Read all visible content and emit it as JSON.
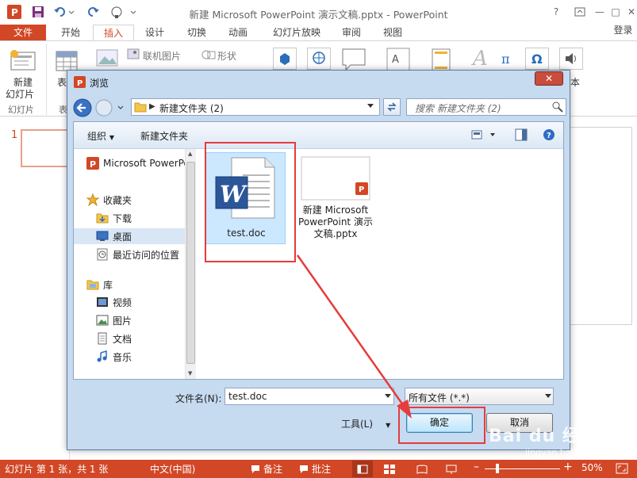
{
  "window": {
    "title": "新建 Microsoft PowerPoint 演示文稿.pptx - PowerPoint",
    "login": "登录",
    "app_icon_letter": "P",
    "window_controls": [
      "?",
      "—",
      "□",
      "✕"
    ]
  },
  "tabs": [
    "文件",
    "开始",
    "插入",
    "设计",
    "切换",
    "动画",
    "幻灯片放映",
    "审阅",
    "视图"
  ],
  "ribbon": {
    "new_slide": "新建\n幻灯片",
    "new_slide_line1": "新建",
    "new_slide_line2": "幻灯片",
    "group_slides": "幻灯片",
    "table": "表",
    "group_table": "表",
    "online_pictures": "联机图片",
    "shapes": "形状",
    "partial_right": "本",
    "accent": "#d24726"
  },
  "slide_pane": {
    "slide_number": "1"
  },
  "dialog": {
    "title": "浏览",
    "close": "✕",
    "address_folder": "新建文件夹 (2)",
    "search_placeholder": "搜索 新建文件夹 (2)",
    "toolbar": {
      "organize": "组织",
      "new_folder": "新建文件夹"
    },
    "nav": {
      "top_item": "Microsoft PowerPoint",
      "favorites": "收藏夹",
      "downloads": "下载",
      "desktop": "桌面",
      "recent": "最近访问的位置",
      "libraries": "库",
      "videos": "视频",
      "pictures": "图片",
      "documents": "文档",
      "music": "音乐"
    },
    "files": [
      {
        "name": "test.doc",
        "type": "word",
        "selected": true
      },
      {
        "name_line1": "新建 Microsoft",
        "name_line2": "PowerPoint 演示",
        "name_line3": "文稿.pptx",
        "type": "pptx",
        "selected": false
      }
    ],
    "filename_label": "文件名(N):",
    "filename_value": "test.doc",
    "filetype_value": "所有文件 (*.*)",
    "tools": "工具(L)",
    "ok": "确定",
    "cancel": "取消"
  },
  "statusbar": {
    "slide_info": "幻灯片 第 1 张，共 1 张",
    "language": "中文(中国)",
    "notes": "备注",
    "comments": "批注",
    "zoom": "50%"
  },
  "watermark": {
    "main": "Bai du 经验",
    "sub": "jingyan.baidu.com"
  },
  "colors": {
    "accent": "#d24726",
    "highlight": "#e53c3c",
    "selection": "#cce8ff"
  }
}
